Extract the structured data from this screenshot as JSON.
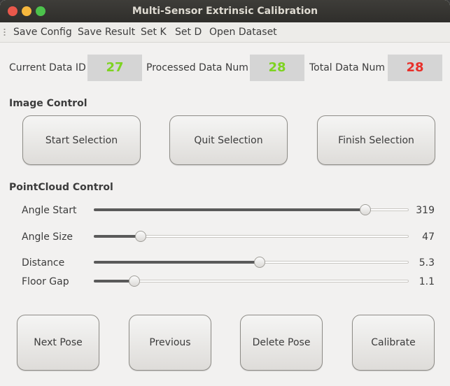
{
  "window": {
    "title": "Multi-Sensor Extrinsic Calibration"
  },
  "menu": [
    {
      "label": "Save Config"
    },
    {
      "label": "Save Result"
    },
    {
      "label": "Set K"
    },
    {
      "label": "Set D"
    },
    {
      "label": "Open Dataset"
    }
  ],
  "stats": {
    "current_label": "Current Data ID",
    "current_value": "27",
    "processed_label": "Processed Data Num",
    "processed_value": "28",
    "total_label": "Total Data Num",
    "total_value": "28",
    "colors": {
      "green": "#7ed321",
      "red": "#e8302a"
    }
  },
  "image_control": {
    "heading": "Image Control",
    "start": "Start Selection",
    "quit": "Quit Selection",
    "finish": "Finish Selection"
  },
  "pointcloud_control": {
    "heading": "PointCloud Control",
    "sliders": [
      {
        "label": "Angle Start",
        "value": "319",
        "fraction": 0.875
      },
      {
        "label": "Angle Size",
        "value": "47",
        "fraction": 0.137
      },
      {
        "label": "Distance",
        "value": "5.3",
        "fraction": 0.528
      },
      {
        "label": "Floor Gap",
        "value": "1.1",
        "fraction": 0.115
      }
    ]
  },
  "actions": {
    "next": "Next Pose",
    "previous": "Previous",
    "delete": "Delete Pose",
    "calibrate": "Calibrate"
  }
}
